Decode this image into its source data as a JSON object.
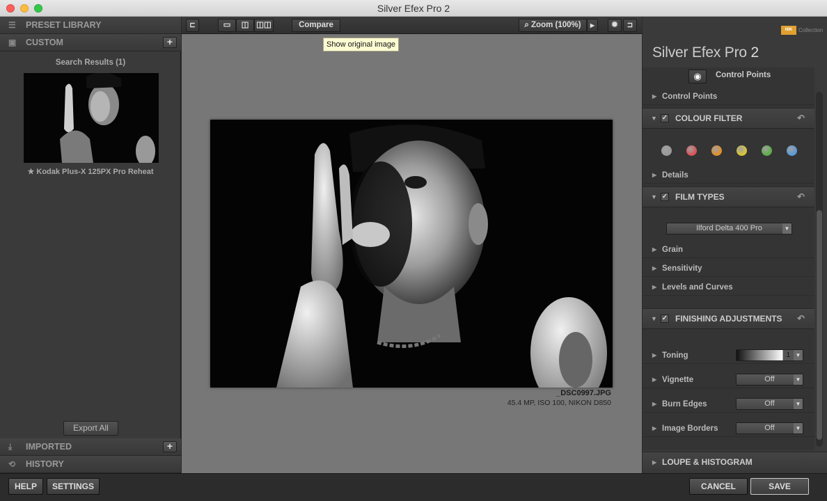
{
  "window": {
    "title": "Silver Efex Pro 2"
  },
  "left_panel": {
    "preset_library": "PRESET LIBRARY",
    "custom": "CUSTOM",
    "search_results": "Search Results (1)",
    "preset_name": "★ Kodak Plus-X 125PX Pro Reheat",
    "export_all": "Export All",
    "imported": "IMPORTED",
    "history": "HISTORY"
  },
  "toolbar": {
    "compare": "Compare",
    "zoom": "Zoom (100%)",
    "tooltip": "Show original image"
  },
  "image_info": {
    "filename": "_DSC0997.JPG",
    "meta": "45.4 MP, ISO 100, NIKON D850"
  },
  "right_panel": {
    "brand": "NIK",
    "brand_sub": "Collection",
    "app_title": "Silver Efex Pro",
    "app_version": "2",
    "control_points_btn": "Control Points",
    "control_points": "Control Points",
    "colour_filter": "COLOUR FILTER",
    "details": "Details",
    "film_types": "FILM TYPES",
    "film_select": "Ilford Delta 400 Pro",
    "grain": "Grain",
    "sensitivity": "Sensitivity",
    "levels_curves": "Levels and Curves",
    "finishing": "FINISHING ADJUSTMENTS",
    "toning": "Toning",
    "toning_value": "1",
    "vignette": "Vignette",
    "vignette_value": "Off",
    "burn_edges": "Burn Edges",
    "burn_value": "Off",
    "image_borders": "Image Borders",
    "borders_value": "Off",
    "loupe": "LOUPE & HISTOGRAM"
  },
  "filter_colors": [
    "#9a9a9a",
    "#d9545a",
    "#e0902e",
    "#d8c43a",
    "#5fae4a",
    "#5b9bd8"
  ],
  "bottom": {
    "help": "HELP",
    "settings": "SETTINGS",
    "cancel": "CANCEL",
    "save": "SAVE"
  }
}
